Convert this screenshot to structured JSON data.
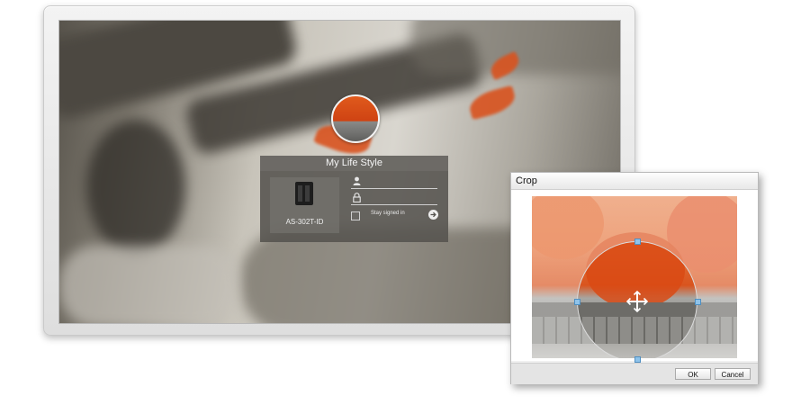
{
  "login": {
    "title": "My Life Style",
    "device_model": "AS-302T-ID",
    "stay_signed_in": "Stay signed in"
  },
  "crop_dialog": {
    "title": "Crop",
    "ok_label": "OK",
    "cancel_label": "Cancel"
  },
  "icons": {
    "user": "user-icon",
    "lock": "lock-icon",
    "go": "arrow-right-icon",
    "move": "move-cross-icon"
  },
  "colors": {
    "card_background": "#55534e",
    "accent_leaves": "#d9531f",
    "crop_handles": "#8fc3ea"
  }
}
